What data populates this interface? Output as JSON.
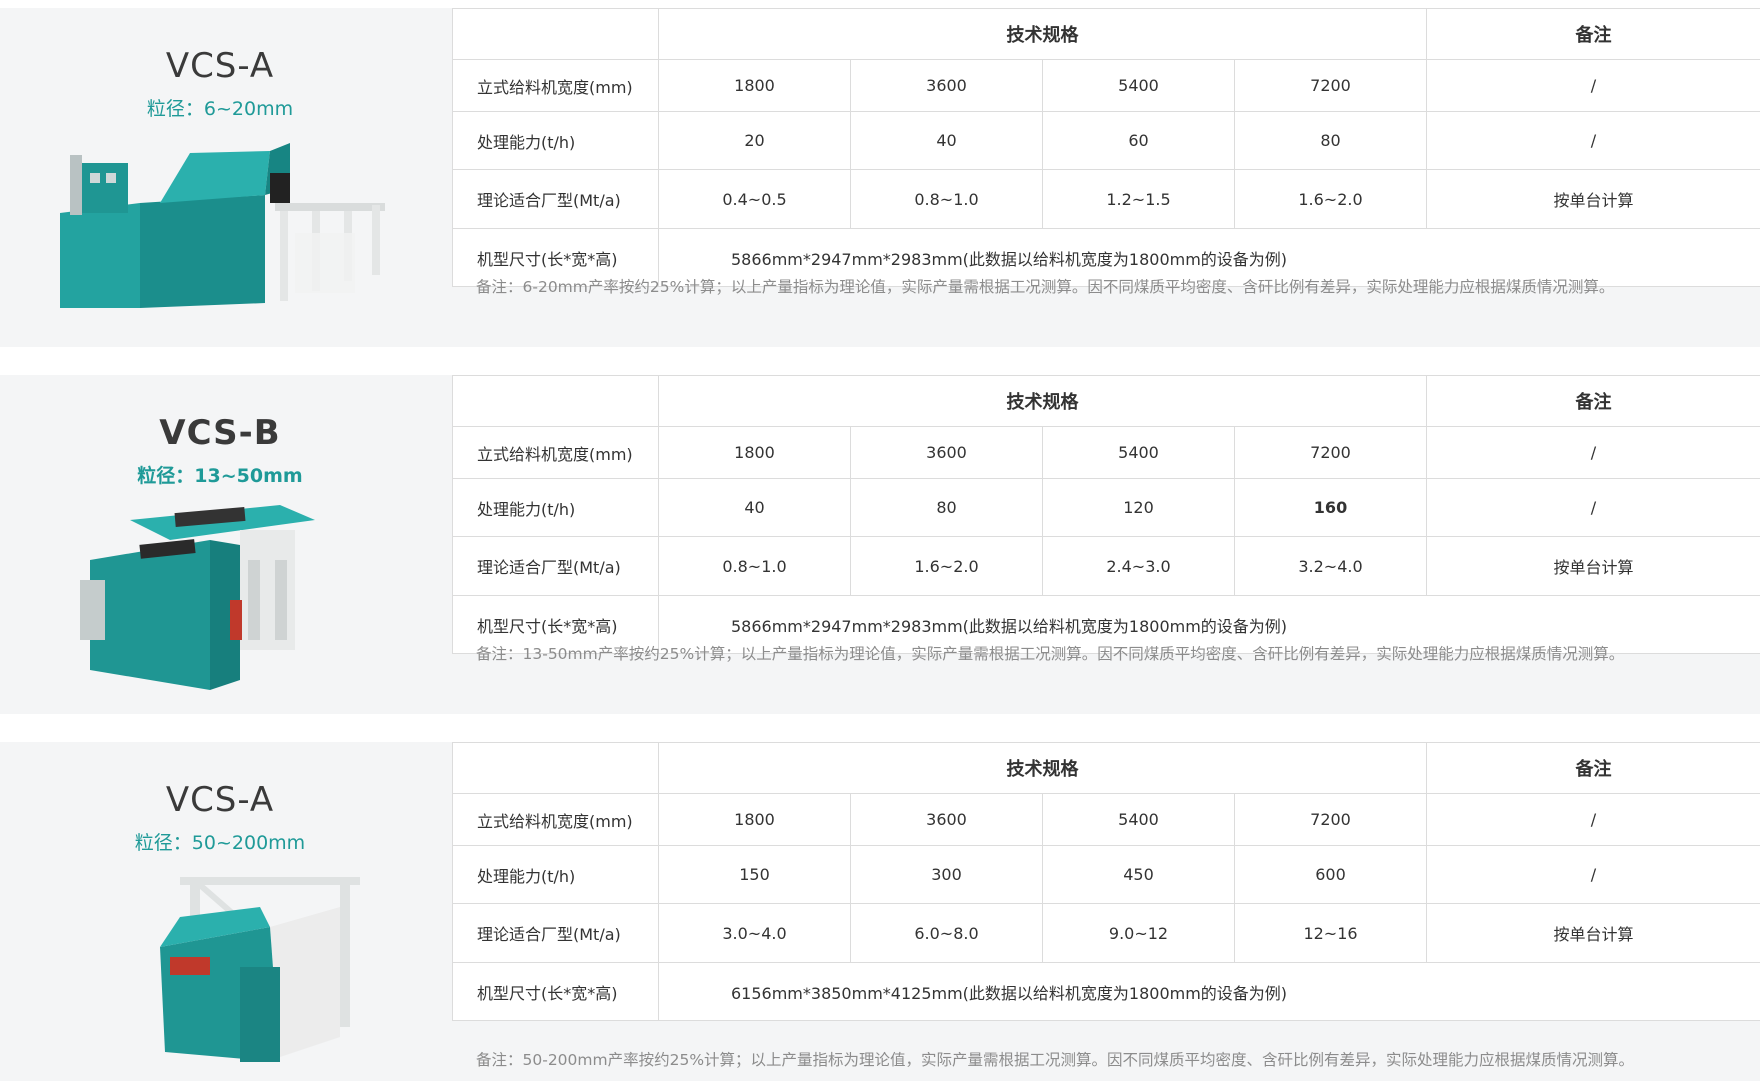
{
  "products": [
    {
      "model": "VCS-A",
      "grain_size": "粒径：6~20mm",
      "spec_header": "技术规格",
      "remark_header": "备注",
      "rows": [
        {
          "label": "立式给料机宽度(mm)",
          "values": [
            "1800",
            "3600",
            "5400",
            "7200"
          ],
          "remark": "/"
        },
        {
          "label": "处理能力(t/h)",
          "values": [
            "20",
            "40",
            "60",
            "80"
          ],
          "remark": "/"
        },
        {
          "label": "理论适合厂型(Mt/a)",
          "values": [
            "0.4~0.5",
            "0.8~1.0",
            "1.2~1.5",
            "1.6~2.0"
          ],
          "remark": "按单台计算"
        }
      ],
      "dimension": {
        "label": "机型尺寸(长*宽*高)",
        "value": "5866mm*2947mm*2983mm(此数据以给料机宽度为1800mm的设备为例)"
      },
      "note": "备注：6-20mm产率按约25%计算；以上产量指标为理论值，实际产量需根据工况测算。因不同煤质平均密度、含矸比例有差异，实际处理能力应根据煤质情况测算。"
    },
    {
      "model": "VCS-B",
      "grain_size": "粒径：13~50mm",
      "spec_header": "技术规格",
      "remark_header": "备注",
      "rows": [
        {
          "label": "立式给料机宽度(mm)",
          "values": [
            "1800",
            "3600",
            "5400",
            "7200"
          ],
          "remark": "/"
        },
        {
          "label": "处理能力(t/h)",
          "values": [
            "40",
            "80",
            "120",
            "160"
          ],
          "remark": "/"
        },
        {
          "label": "理论适合厂型(Mt/a)",
          "values": [
            "0.8~1.0",
            "1.6~2.0",
            "2.4~3.0",
            "3.2~4.0"
          ],
          "remark": "按单台计算"
        }
      ],
      "dimension": {
        "label": "机型尺寸(长*宽*高)",
        "value": "5866mm*2947mm*2983mm(此数据以给料机宽度为1800mm的设备为例)"
      },
      "note": "备注：13-50mm产率按约25%计算；以上产量指标为理论值，实际产量需根据工况测算。因不同煤质平均密度、含矸比例有差异，实际处理能力应根据煤质情况测算。"
    },
    {
      "model": "VCS-A",
      "grain_size": "粒径：50~200mm",
      "spec_header": "技术规格",
      "remark_header": "备注",
      "rows": [
        {
          "label": "立式给料机宽度(mm)",
          "values": [
            "1800",
            "3600",
            "5400",
            "7200"
          ],
          "remark": "/"
        },
        {
          "label": "处理能力(t/h)",
          "values": [
            "150",
            "300",
            "450",
            "600"
          ],
          "remark": "/"
        },
        {
          "label": "理论适合厂型(Mt/a)",
          "values": [
            "3.0~4.0",
            "6.0~8.0",
            "9.0~12",
            "12~16"
          ],
          "remark": "按单台计算"
        }
      ],
      "dimension": {
        "label": "机型尺寸(长*宽*高)",
        "value": "6156mm*3850mm*4125mm(此数据以给料机宽度为1800mm的设备为例)"
      },
      "note": "备注：50-200mm产率按约25%计算；以上产量指标为理论值，实际产量需根据工况测算。因不同煤质平均密度、含矸比例有差异，实际处理能力应根据煤质情况测算。"
    }
  ]
}
